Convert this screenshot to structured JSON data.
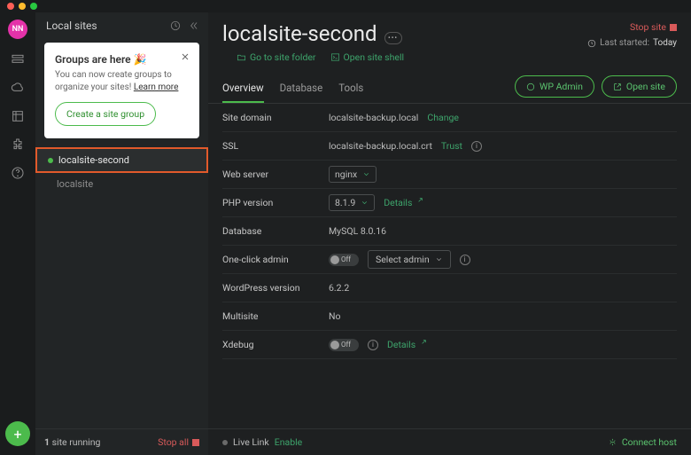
{
  "avatar": "NN",
  "sidebar": {
    "title": "Local sites",
    "banner": {
      "title": "Groups are here 🎉",
      "subtitle_l1": "You can now create groups to",
      "subtitle_l2": "organize your sites!",
      "learn_more": "Learn more",
      "button": "Create a site group"
    },
    "sites": [
      {
        "name": "localsite-second",
        "selected": true,
        "running": true
      },
      {
        "name": "localsite",
        "selected": false,
        "running": false
      }
    ],
    "footer_running_count": "1",
    "footer_running_label": "site running",
    "stop_all": "Stop all"
  },
  "main": {
    "title": "localsite-second",
    "stop_site": "Stop site",
    "last_started_label": "Last started:",
    "last_started_value": "Today",
    "links": {
      "folder": "Go to site folder",
      "shell": "Open site shell"
    },
    "tabs": [
      "Overview",
      "Database",
      "Tools"
    ],
    "active_tab": "Overview",
    "buttons": {
      "wp_admin": "WP Admin",
      "open_site": "Open site"
    },
    "rows": {
      "site_domain": {
        "label": "Site domain",
        "value": "localsite-backup.local",
        "action": "Change"
      },
      "ssl": {
        "label": "SSL",
        "value": "localsite-backup.local.crt",
        "action": "Trust"
      },
      "web_server": {
        "label": "Web server",
        "value": "nginx"
      },
      "php": {
        "label": "PHP version",
        "value": "8.1.9",
        "details": "Details"
      },
      "database": {
        "label": "Database",
        "value": "MySQL 8.0.16"
      },
      "one_click": {
        "label": "One-click admin",
        "toggle": "Off",
        "select": "Select admin"
      },
      "wp_version": {
        "label": "WordPress version",
        "value": "6.2.2"
      },
      "multisite": {
        "label": "Multisite",
        "value": "No"
      },
      "xdebug": {
        "label": "Xdebug",
        "toggle": "Off",
        "details": "Details"
      }
    },
    "footer": {
      "live_link": "Live Link",
      "enable": "Enable",
      "connect": "Connect host"
    }
  }
}
